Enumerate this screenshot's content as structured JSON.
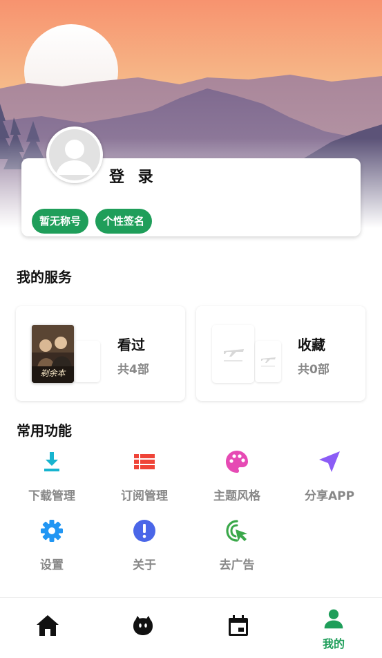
{
  "profile": {
    "login_label": "登 录",
    "badges": [
      "暂无称号",
      "个性签名"
    ]
  },
  "services": {
    "title": "我的服务",
    "watched": {
      "title": "看过",
      "count": "共4部",
      "poster_text": "剃余本"
    },
    "favorites": {
      "title": "收藏",
      "count": "共0部"
    }
  },
  "functions": {
    "title": "常用功能",
    "items": [
      {
        "label": "下载管理",
        "icon": "download-icon",
        "color": "#17b4cf"
      },
      {
        "label": "订阅管理",
        "icon": "list-icon",
        "color": "#ef4438"
      },
      {
        "label": "主题风格",
        "icon": "palette-icon",
        "color": "#e64ab4"
      },
      {
        "label": "分享APP",
        "icon": "navigation-arrow-icon",
        "color": "#8b5cf6"
      },
      {
        "label": "设置",
        "icon": "gear-icon",
        "color": "#2196f3"
      },
      {
        "label": "关于",
        "icon": "info-icon",
        "color": "#4a66e8"
      },
      {
        "label": "去广告",
        "icon": "cursor-click-icon",
        "color": "#3aa84a"
      }
    ]
  },
  "bottom_nav": {
    "items": [
      {
        "icon": "home-icon"
      },
      {
        "icon": "mascot-icon"
      },
      {
        "icon": "calendar-icon"
      },
      {
        "icon": "person-icon",
        "label": "我的",
        "active": true
      }
    ],
    "active_color": "#1f9e5a"
  },
  "colors": {
    "accent": "#1f9e5a",
    "sky_top": "#f79a76",
    "sky_mid": "#f6c08f"
  }
}
